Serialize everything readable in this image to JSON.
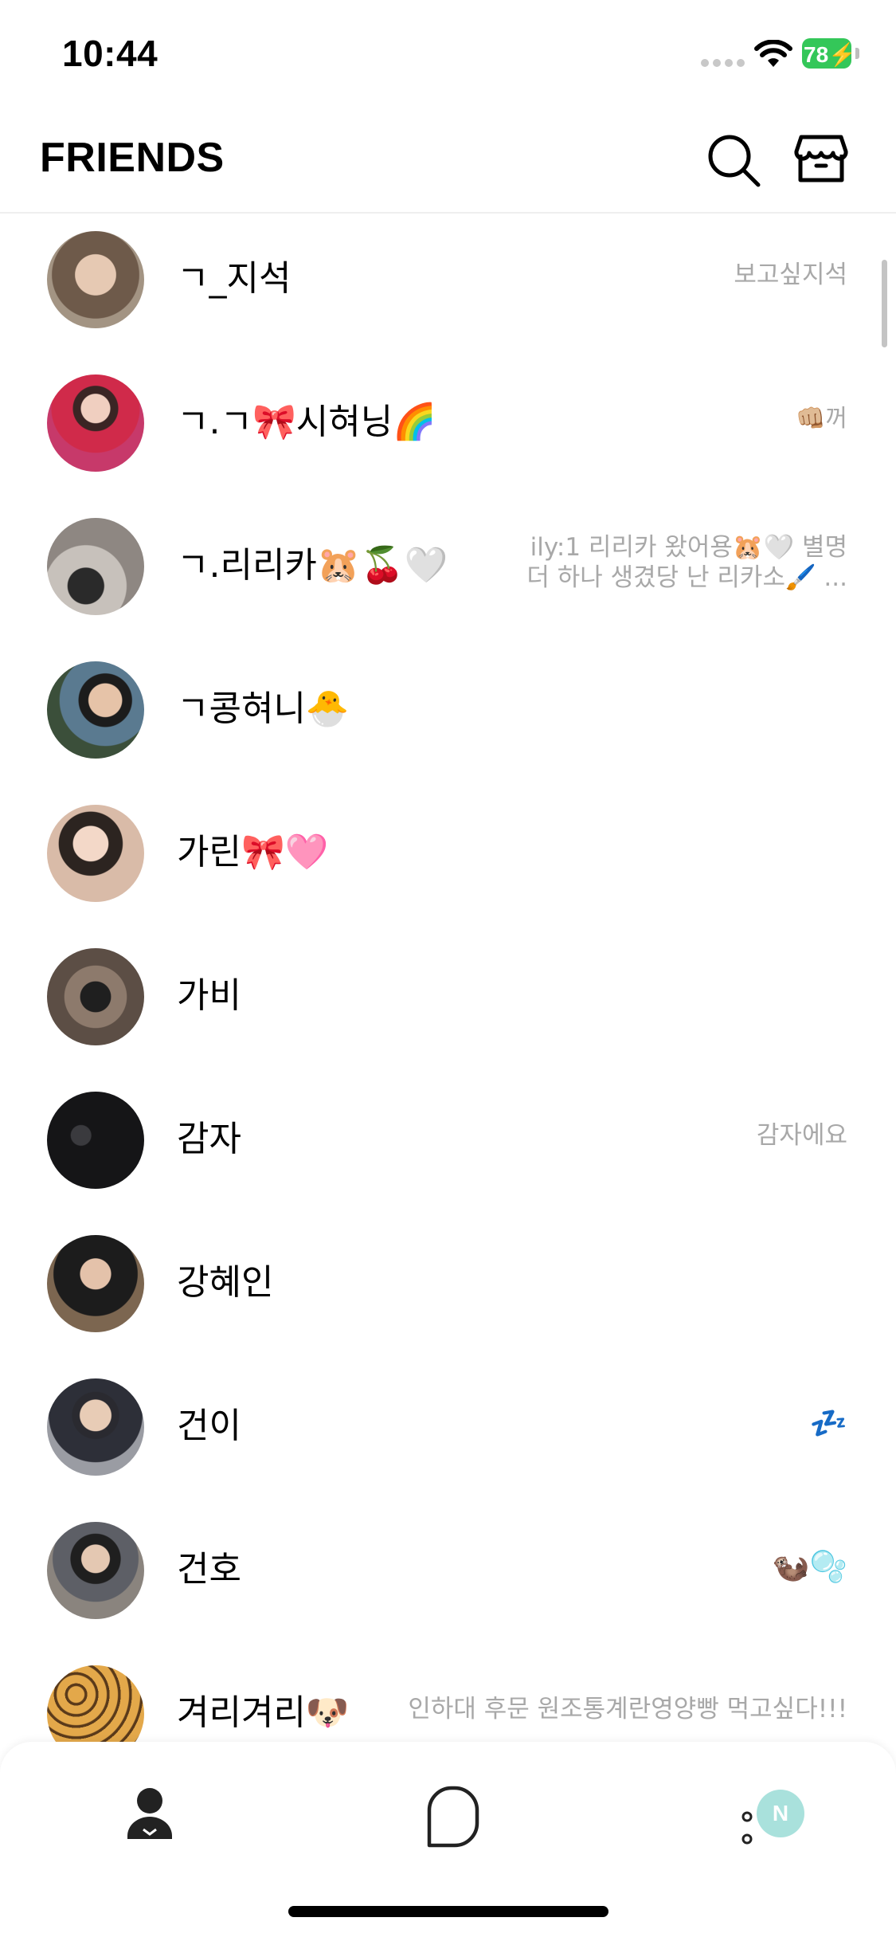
{
  "status_bar": {
    "time": "10:44",
    "battery": "78",
    "icons": [
      "cellular-dots-icon",
      "wifi-icon",
      "battery-icon",
      "charging-bolt-icon"
    ]
  },
  "header": {
    "title": "FRIENDS",
    "icons": [
      "search-icon",
      "shop-icon"
    ]
  },
  "friends": [
    {
      "name": "ㄱ_지석",
      "status": "보고싶지석",
      "avatar_color": "#8b7a68"
    },
    {
      "name": "ㄱ.ㄱ🎀시혀닝🌈",
      "status": "👊🏼꺼",
      "avatar_color": "#c23a6a"
    },
    {
      "name": "ㄱ.리리카🐹🍒🤍",
      "status": "ily:1 리리카 왔어용🐹🤍 별명\n더 하나 생겼당 난 리카소🖌️ ...",
      "avatar_color": "#9a9490"
    },
    {
      "name": "ㄱ콩혀니🐣",
      "status": "",
      "avatar_color": "#4b6d86"
    },
    {
      "name": "가린🎀🩷",
      "status": "",
      "avatar_color": "#c9a99a"
    },
    {
      "name": "가비",
      "status": "",
      "avatar_color": "#6a5a50"
    },
    {
      "name": "감자",
      "status": "감자에요",
      "avatar_color": "#1b1b1d"
    },
    {
      "name": "강혜인",
      "status": "",
      "avatar_color": "#3a3530"
    },
    {
      "name": "건이",
      "status": "💤",
      "avatar_color": "#6c6f78"
    },
    {
      "name": "건호",
      "status": "🦦🫧",
      "avatar_color": "#4e4a48"
    },
    {
      "name": "겨리겨리🐶",
      "status": "인하대 후문 원조통계란영양빵 먹고싶다!!!",
      "avatar_color": "#b9813d"
    }
  ],
  "tab_bar": {
    "tabs": [
      {
        "name": "friends",
        "icon": "person-icon"
      },
      {
        "name": "chats",
        "icon": "chat-bubble-icon"
      },
      {
        "name": "more",
        "icon": "more-dots-icon",
        "badge": "N"
      }
    ],
    "badge_color": "#a9e1dc"
  }
}
